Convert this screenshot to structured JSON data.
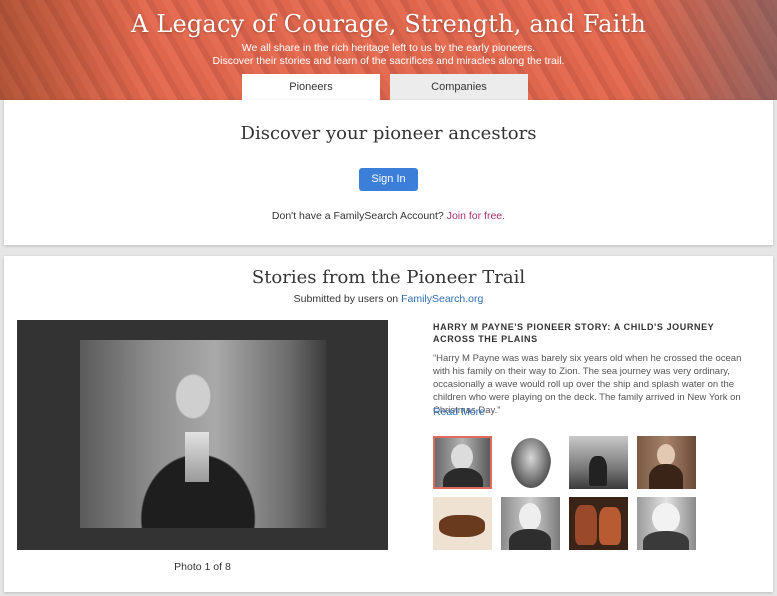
{
  "hero": {
    "title": "A Legacy of Courage, Strength, and Faith",
    "subtitle_line1": "We all share in the rich heritage left to us by the early pioneers.",
    "subtitle_line2": "Discover their stories and learn of the sacrifices and miracles along the trail.",
    "tabs": [
      {
        "label": "Pioneers",
        "active": true
      },
      {
        "label": "Companies",
        "active": false
      }
    ]
  },
  "discover": {
    "title": "Discover your pioneer ancestors",
    "sign_in_label": "Sign In",
    "account_prompt": "Don't have a FamilySearch Account?",
    "join_label": "Join for free."
  },
  "stories": {
    "title": "Stories from the Pioneer Trail",
    "submitted_prefix": "Submitted by users on",
    "submitted_link": "FamilySearch.org",
    "photo_counter": "Photo 1 of 8",
    "story_title": "Harry M Payne's Pioneer Story: A Child's Journey Across the Plains",
    "story_text": "“Harry M Payne was was barely six years old when he crossed the ocean with his family on their way to Zion. The sea journey was very ordinary, occasionally a wave would roll up over the ship and splash water on the children who were playing on the deck. The family arrived in New York on Christmas Day.”",
    "read_more_label": "Read More",
    "thumbnails": [
      {
        "icon": "portrait-man-mustache-thumb",
        "selected": true
      },
      {
        "icon": "portrait-bearded-man-oval-thumb",
        "selected": false
      },
      {
        "icon": "ship-deck-men-thumb",
        "selected": false
      },
      {
        "icon": "portrait-woman-sepia-thumb",
        "selected": false
      },
      {
        "icon": "cattle-drawing-thumb",
        "selected": false
      },
      {
        "icon": "portrait-old-bearded-man-thumb",
        "selected": false
      },
      {
        "icon": "worn-boots-thumb",
        "selected": false
      },
      {
        "icon": "portrait-old-woman-bonnet-thumb",
        "selected": false
      }
    ]
  },
  "colors": {
    "accent_blue": "#3b7fd9",
    "link_blue": "#2f6fb5",
    "join_magenta": "#a3316b",
    "hero_overlay": "#e86450",
    "selected_border": "#e26a5d"
  }
}
